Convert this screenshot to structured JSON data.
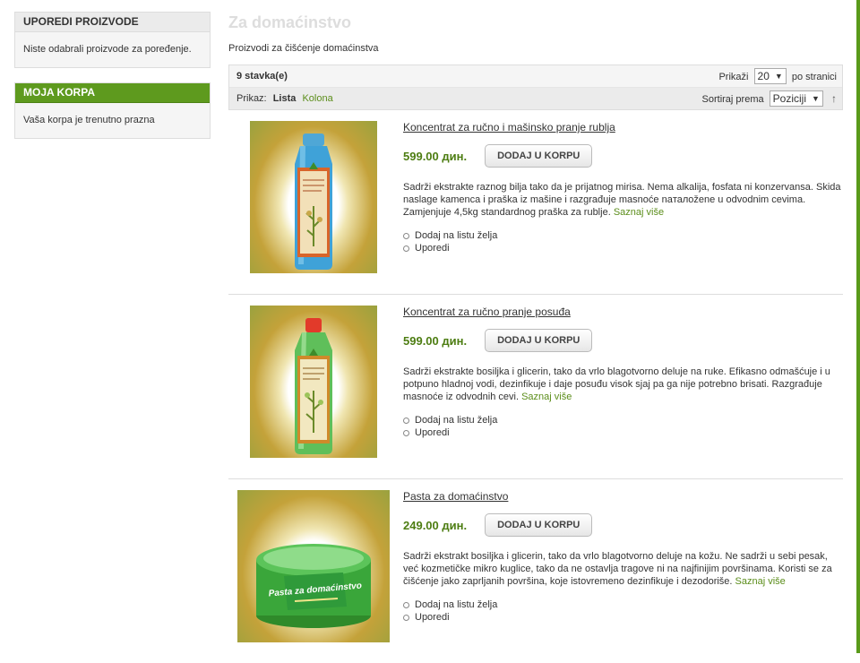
{
  "sidebar": {
    "compare": {
      "title": "UPOREDI PROIZVODE",
      "text": "Niste odabrali proizvode za poređenje."
    },
    "cart": {
      "title": "MOJA KORPA",
      "text": "Vaša korpa je trenutno prazna"
    }
  },
  "main": {
    "title": "Za domaćinstvo",
    "description": "Proizvodi za čišćenje domaćinstva"
  },
  "toolbar": {
    "count": "9 stavka(e)",
    "show_label": "Prikaži",
    "show_value": "20",
    "per_page": "po stranici",
    "view_label": "Prikaz:",
    "view_list": "Lista",
    "view_grid": "Kolona",
    "sort_label": "Sortiraj prema",
    "sort_value": "Poziciji"
  },
  "products": [
    {
      "name": "Koncentrat za ručno i mašinsko pranje rublja",
      "price": "599.00 дин.",
      "button": "DODAJ U KORPU",
      "description": "Sadrži ekstrakte raznog bilja tako da je prijatnog mirisa. Nema alkalija, fosfata ni konzervansa. Skida naslage kamenca i praška iz mašine i razgrađuje masnoće naталožene u odvodnim cevima. Zamjenjuje 4,5kg standardnog praška za rublje.",
      "more": "Saznaj više",
      "wishlist": "Dodaj na listu želja",
      "compare": "Uporedi"
    },
    {
      "name": "Koncentrat za ručno pranje posuđa",
      "price": "599.00 дин.",
      "button": "DODAJ U KORPU",
      "description": "Sadrži ekstrakte bosiljka i glicerin, tako da vrlo blagotvorno deluje na ruke. Efikasno odmašćuje i u potpuno hladnoj vodi, dezinfikuje i daje posuđu visok sjaj pa ga nije potrebno brisati. Razgrađuje masnoće iz odvodnih cevi.",
      "more": "Saznaj više",
      "wishlist": "Dodaj na listu želja",
      "compare": "Uporedi"
    },
    {
      "name": "Pasta za domaćinstvo",
      "price": "249.00 дин.",
      "button": "DODAJ U KORPU",
      "description": "Sadrži ekstrakt bosiljka i glicerin, tako da vrlo blagotvorno deluje na kožu. Ne sadrži u sebi pesak, već kozmetičke mikro kuglice, tako da ne ostavlja tragove ni na najfinijim površinama. Koristi se za čišćenje jako zaprljanih površina, koje istovremeno dezinfikuje i dezodoriše.",
      "more": "Saznaj više",
      "wishlist": "Dodaj na listu želja",
      "compare": "Uporedi",
      "image_label": "Pasta za domaćinstvo"
    }
  ],
  "colors": {
    "accent_green": "#5e9a1e",
    "price_green": "#4d7d12",
    "link_green": "#5b8d1a"
  }
}
